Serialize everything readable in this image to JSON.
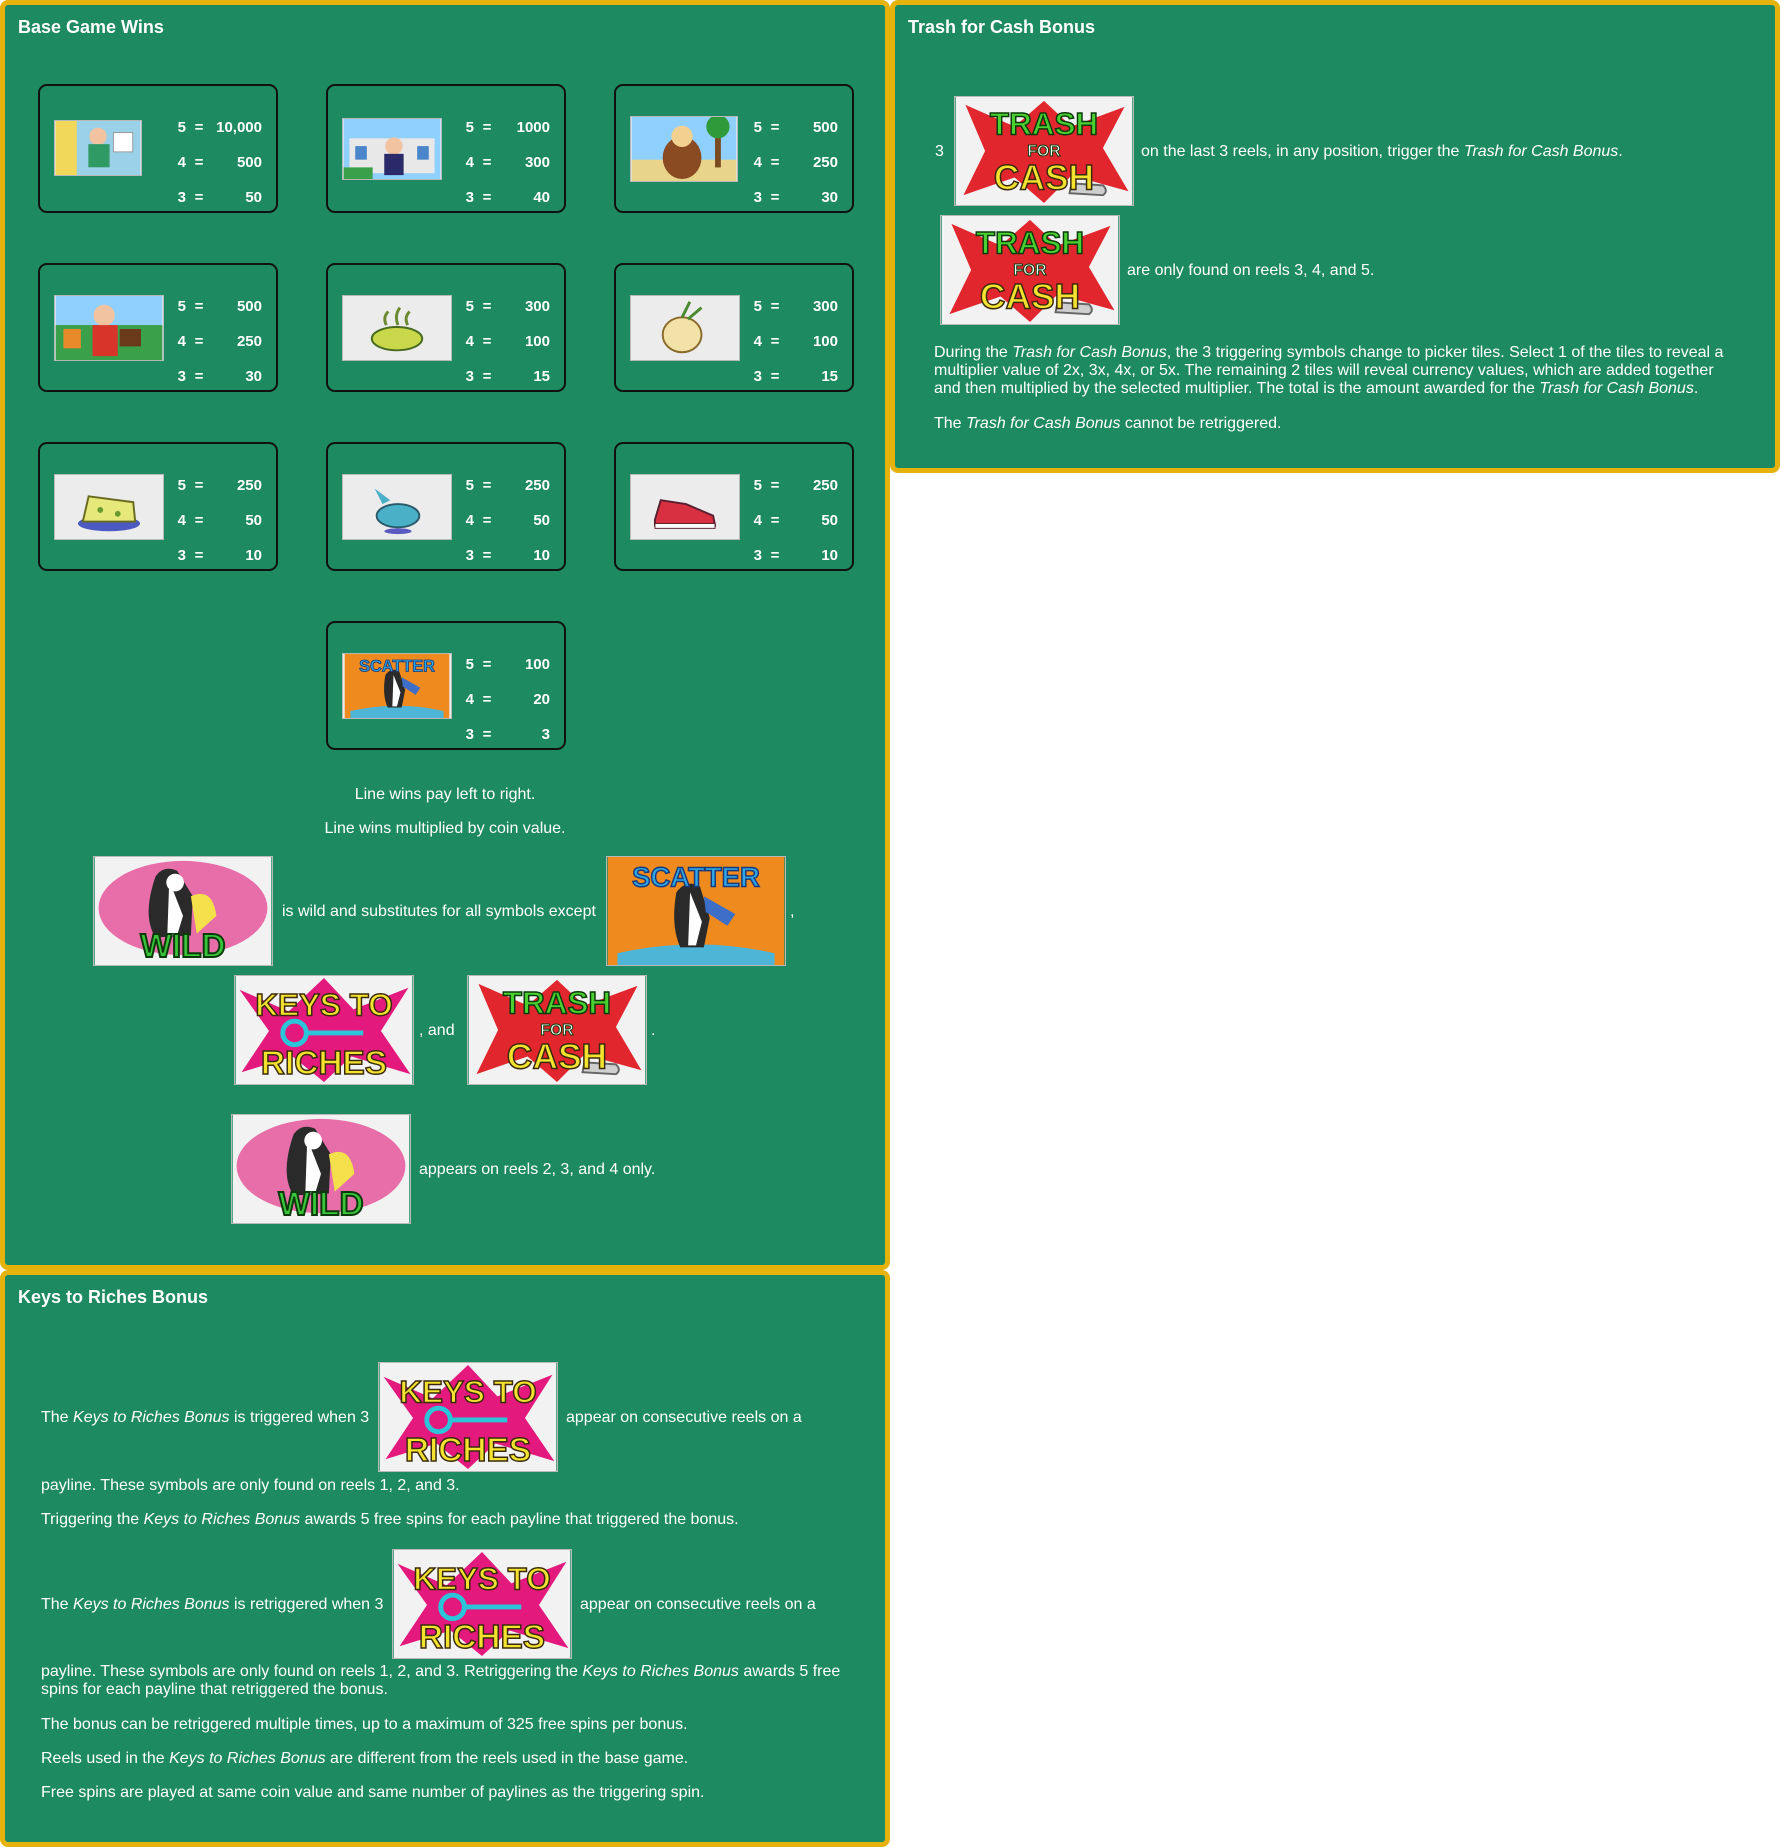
{
  "base_game": {
    "title": "Base Game Wins",
    "paytable": [
      {
        "symbol": "grandma-icon",
        "pays": [
          {
            "count": "5",
            "value": "10,000"
          },
          {
            "count": "4",
            "value": "500"
          },
          {
            "count": "3",
            "value": "50"
          }
        ]
      },
      {
        "symbol": "mansion-man-icon",
        "pays": [
          {
            "count": "5",
            "value": "1000"
          },
          {
            "count": "4",
            "value": "300"
          },
          {
            "count": "3",
            "value": "40"
          }
        ]
      },
      {
        "symbol": "beach-bear-icon",
        "pays": [
          {
            "count": "5",
            "value": "500"
          },
          {
            "count": "4",
            "value": "250"
          },
          {
            "count": "3",
            "value": "30"
          }
        ]
      },
      {
        "symbol": "salesman-icon",
        "pays": [
          {
            "count": "5",
            "value": "500"
          },
          {
            "count": "4",
            "value": "250"
          },
          {
            "count": "3",
            "value": "30"
          }
        ]
      },
      {
        "symbol": "soup-bowl-icon",
        "pays": [
          {
            "count": "5",
            "value": "300"
          },
          {
            "count": "4",
            "value": "100"
          },
          {
            "count": "3",
            "value": "15"
          }
        ]
      },
      {
        "symbol": "onion-icon",
        "pays": [
          {
            "count": "5",
            "value": "300"
          },
          {
            "count": "4",
            "value": "100"
          },
          {
            "count": "3",
            "value": "15"
          }
        ]
      },
      {
        "symbol": "cheese-icon",
        "pays": [
          {
            "count": "5",
            "value": "250"
          },
          {
            "count": "4",
            "value": "50"
          },
          {
            "count": "3",
            "value": "10"
          }
        ]
      },
      {
        "symbol": "fish-icon",
        "pays": [
          {
            "count": "5",
            "value": "250"
          },
          {
            "count": "4",
            "value": "50"
          },
          {
            "count": "3",
            "value": "10"
          }
        ]
      },
      {
        "symbol": "sneaker-icon",
        "pays": [
          {
            "count": "5",
            "value": "250"
          },
          {
            "count": "4",
            "value": "50"
          },
          {
            "count": "3",
            "value": "10"
          }
        ]
      },
      {
        "symbol": "scatter-skunk-icon",
        "pays": [
          {
            "count": "5",
            "value": "100"
          },
          {
            "count": "4",
            "value": "20"
          },
          {
            "count": "3",
            "value": "3"
          }
        ]
      }
    ],
    "line_left_to_right": "Line wins pay left to right.",
    "line_multiplied": "Line wins multiplied by coin value.",
    "wild_text": "is wild and substitutes for all symbols except",
    "comma": ",",
    "and_text": ", and",
    "period": ".",
    "wild_reels_text": "appears on reels 2, 3, and 4 only."
  },
  "symbols": {
    "wild_label": "WILD",
    "scatter_label": "SCATTER",
    "keys_line1": "KEYS TO",
    "keys_line2": "RICHES",
    "trash_line1": "TRASH",
    "trash_line2": "FOR",
    "trash_line3": "CASH"
  },
  "trash_bonus": {
    "title": "Trash for Cash Bonus",
    "count": "3",
    "trigger_pre": "on the last 3 reels, in any position, trigger the ",
    "trigger_name": "Trash for Cash Bonus",
    "trigger_post": ".",
    "reels_text": "are only found on reels 3, 4, and 5.",
    "during_pre": "During the ",
    "during_name": "Trash for Cash Bonus",
    "during_mid": ", the 3 triggering symbols change to picker tiles. Select 1 of the tiles to reveal a multiplier value of 2x, 3x, 4x, or 5x. The remaining 2 tiles will reveal currency values, which are added together and then multiplied by the selected multiplier. The total is the amount awarded for the ",
    "during_name2": "Trash for Cash Bonus",
    "during_post": ".",
    "retrig_pre": "The ",
    "retrig_name": "Trash for Cash Bonus",
    "retrig_post": " cannot be retriggered."
  },
  "keys_bonus": {
    "title": "Keys to Riches Bonus",
    "p1_pre": "The ",
    "p1_name": "Keys to Riches Bonus",
    "p1_mid": " is triggered when 3",
    "p1_post": "appear on consecutive reels on a",
    "p1_cont": "payline. These symbols are only found on reels 1, 2, and 3.",
    "p2_pre": "Triggering the ",
    "p2_name": "Keys to Riches Bonus",
    "p2_post": " awards 5 free spins for each payline that triggered the bonus.",
    "p3_pre": "The ",
    "p3_name": "Keys to Riches Bonus",
    "p3_mid": " is retriggered when 3",
    "p3_post": "appear on consecutive reels on a",
    "p3_cont_pre": "payline. These symbols are only found on reels 1, 2, and 3. Retriggering the ",
    "p3_cont_name": "Keys to Riches Bonus",
    "p3_cont_post": " awards 5 free spins for each payline that retriggered the bonus.",
    "p4": "The bonus can be retriggered multiple times, up to a maximum of 325 free spins per bonus.",
    "p5_pre": "Reels used in the ",
    "p5_name": "Keys to Riches Bonus",
    "p5_post": " are different from the reels used in the base game.",
    "p6": "Free spins are played at same coin value and same number of paylines as the triggering spin."
  },
  "colors": {
    "panel_bg": "#1e8a62",
    "panel_border": "#e6b30c",
    "text": "#ffffff"
  }
}
